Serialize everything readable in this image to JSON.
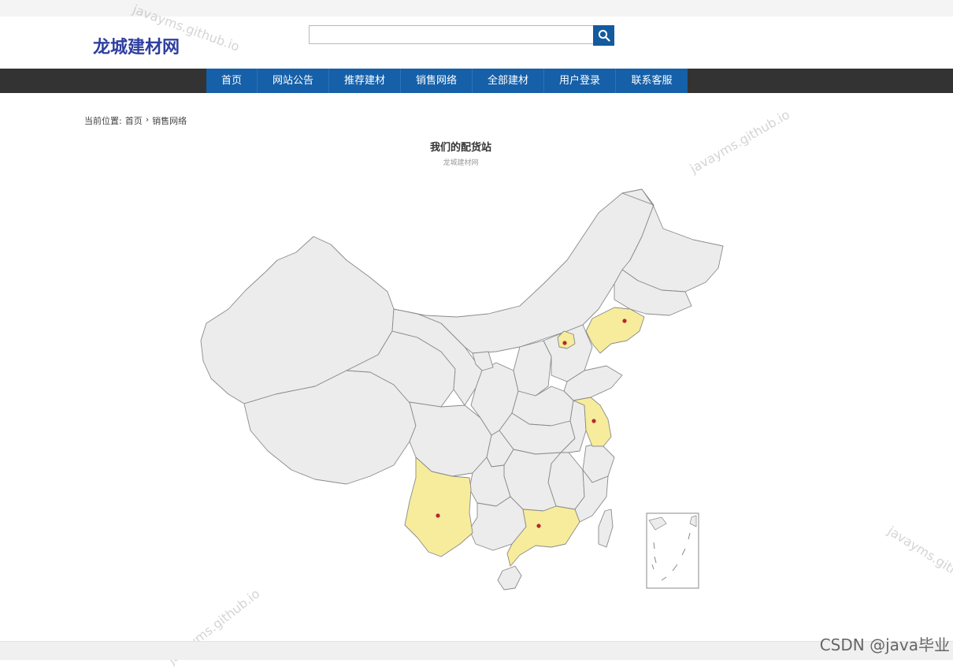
{
  "site": {
    "logo": "龙城建材网"
  },
  "search": {
    "placeholder": "",
    "value": ""
  },
  "nav": {
    "items": [
      {
        "label": "首页"
      },
      {
        "label": "网站公告"
      },
      {
        "label": "推荐建材"
      },
      {
        "label": "销售网络"
      },
      {
        "label": "全部建材"
      },
      {
        "label": "用户登录"
      },
      {
        "label": "联系客服"
      }
    ]
  },
  "breadcrumb": {
    "prefix": "当前位置:",
    "home": "首页",
    "separator": "›",
    "current": "销售网络"
  },
  "map": {
    "title": "我们的配货站",
    "subtitle": "龙城建材网",
    "base_color": "#ececec",
    "highlight_color": "#f6ec9c",
    "marker_color": "#b5282c",
    "highlighted_regions": [
      "北京",
      "辽宁",
      "江苏",
      "云南",
      "广东"
    ]
  },
  "watermarks": [
    "javayms.github.io",
    "javayms.github.io",
    "javayms.github.io",
    "javayms.github.io"
  ],
  "footer": {
    "credit": "CSDN @java毕业"
  }
}
